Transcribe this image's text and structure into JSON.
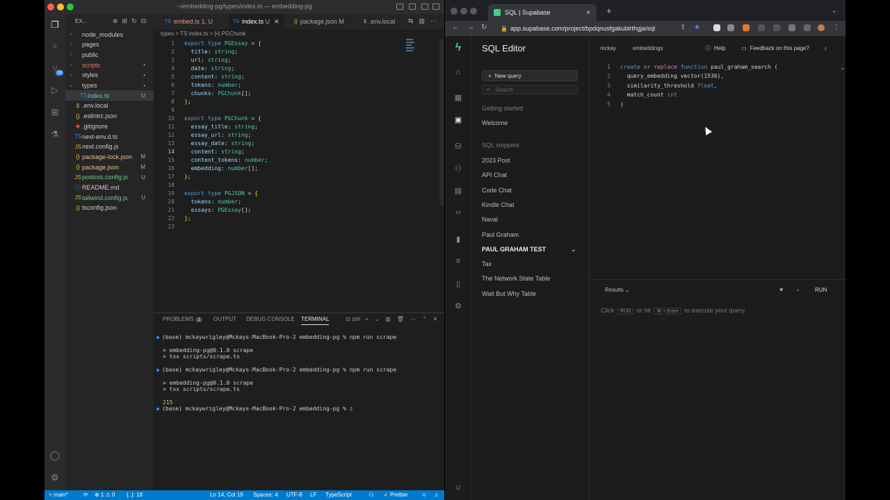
{
  "vscode": {
    "title": "~/embedding-pg/types/index.ts — embedding-pg",
    "explorer_label": "EX...",
    "tree": [
      {
        "name": "node_modules",
        "kind": "folder",
        "status": ""
      },
      {
        "name": "pages",
        "kind": "folder",
        "status": ""
      },
      {
        "name": "public",
        "kind": "folder",
        "status": ""
      },
      {
        "name": "scripts",
        "kind": "folder",
        "status": "•"
      },
      {
        "name": "styles",
        "kind": "folder",
        "status": "•"
      },
      {
        "name": "types",
        "kind": "folder-open",
        "status": "•"
      },
      {
        "name": "index.ts",
        "kind": "ts",
        "status": "U"
      },
      {
        "name": ".env.local",
        "kind": "env",
        "status": ""
      },
      {
        "name": ".eslintrc.json",
        "kind": "json",
        "status": ""
      },
      {
        "name": ".gitignore",
        "kind": "git",
        "status": ""
      },
      {
        "name": "next-env.d.ts",
        "kind": "ts",
        "status": ""
      },
      {
        "name": "next.config.js",
        "kind": "js",
        "status": ""
      },
      {
        "name": "package-lock.json",
        "kind": "json",
        "status": "M"
      },
      {
        "name": "package.json",
        "kind": "json",
        "status": "M"
      },
      {
        "name": "postcss.config.js",
        "kind": "js",
        "status": "U"
      },
      {
        "name": "README.md",
        "kind": "md",
        "status": ""
      },
      {
        "name": "tailwind.config.js",
        "kind": "js",
        "status": "U"
      },
      {
        "name": "tsconfig.json",
        "kind": "json",
        "status": ""
      }
    ],
    "tabs": [
      {
        "label": "embed.ts",
        "suffix": "1, U",
        "lang": "TS"
      },
      {
        "label": "index.ts",
        "suffix": "U",
        "lang": "TS"
      },
      {
        "label": "package.json",
        "suffix": "M",
        "lang": "{}"
      },
      {
        "label": ".env.local",
        "suffix": "",
        "lang": "$"
      }
    ],
    "breadcrumb": "types > TS index.ts > {•} PGChunk",
    "code_lines": [
      "export type PGEssay = {",
      "  title: string;",
      "  url: string;",
      "  date: string;",
      "  content: string;",
      "  tokens: number;",
      "  chunks: PGChunk[];",
      "};",
      "",
      "export type PGChunk = {",
      "  essay_title: string;",
      "  essay_url: string;",
      "  essay_date: string;",
      "  content: string;",
      "  content_tokens: number;",
      "  embedding: number[];",
      "};",
      "",
      "export type PGJSON = {",
      "  tokens: number;",
      "  essays: PGEssay[];",
      "};",
      ""
    ],
    "current_line": 14,
    "panel_tabs": {
      "problems": "PROBLEMS",
      "problems_count": "1",
      "output": "OUTPUT",
      "debug": "DEBUG CONSOLE",
      "terminal": "TERMINAL",
      "shell": "zsh"
    },
    "terminal_lines": [
      {
        "text": "(base) mckaywrigley@Mckays-MacBook-Pro-2 embedding-pg % npm run scrape",
        "dot": true
      },
      {
        "text": "",
        "dot": false
      },
      {
        "text": "> embedding-pg@0.1.0 scrape",
        "dot": false
      },
      {
        "text": "> tsx scripts/scrape.ts",
        "dot": false
      },
      {
        "text": "",
        "dot": false
      },
      {
        "text": "(base) mckaywrigley@Mckays-MacBook-Pro-2 embedding-pg % npm run scrape",
        "dot": true
      },
      {
        "text": "",
        "dot": false
      },
      {
        "text": "> embedding-pg@0.1.0 scrape",
        "dot": false
      },
      {
        "text": "> tsx scripts/scrape.ts",
        "dot": false
      },
      {
        "text": "",
        "dot": false
      },
      {
        "text": "215",
        "dot": false
      },
      {
        "text": "(base) mckaywrigley@Mckays-MacBook-Pro-2 embedding-pg % ",
        "dot": true
      }
    ],
    "status": {
      "branch": "main*",
      "errors": "⊗ 1 ⚠ 0",
      "extra": "{..}: 18",
      "position": "Ln 14, Col 19",
      "spaces": "Spaces: 4",
      "encoding": "UTF-8",
      "eol": "LF",
      "language": "TypeScript",
      "prettier": "✓ Prettier"
    }
  },
  "browser": {
    "tab_title": "SQL | Supabase",
    "url": "app.supabase.com/project/bpdqnusfgakublrthgja/sql",
    "app_title": "SQL Editor",
    "new_query": "New query",
    "search_placeholder": "Search",
    "getting_started": "Getting started",
    "welcome": "Welcome",
    "snippets_label": "SQL snippets",
    "snippets": [
      "2023 Post",
      "API Chat",
      "Code Chat",
      "Kindle Chat",
      "Naval",
      "Paul Graham",
      "PAUL GRAHAM TEST",
      "Tax",
      "The Network State Table",
      "Wait But Why Table"
    ],
    "org": "mckay",
    "project": "embeddings",
    "help": "Help",
    "feedback": "Feedback on this page?",
    "sql_lines": [
      "create or replace function paul_graham_search (",
      "  query_embedding vector(1536),",
      "  similarity_threshold float,",
      "  match_count int",
      ")"
    ],
    "results_label": "Results",
    "run_label": "RUN",
    "hint_click": "Click",
    "hint_run": "RUN",
    "hint_or": "or hit",
    "hint_keys": "⌘ + Enter",
    "hint_tail": "to execute your query."
  }
}
